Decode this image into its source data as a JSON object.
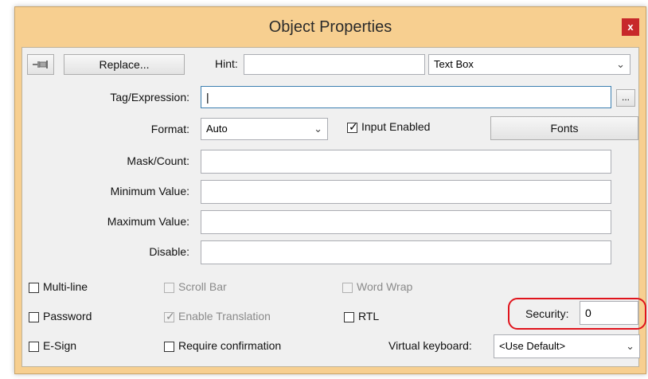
{
  "window": {
    "title": "Object Properties",
    "close_glyph": "x",
    "accent_color": "#f7cf90",
    "close_color": "#c7282a"
  },
  "toolbar": {
    "pin_icon": "pushpin-icon",
    "replace_label": "Replace...",
    "hint_label": "Hint:",
    "hint_value": "",
    "type_selected": "Text Box"
  },
  "fields": {
    "tag_label": "Tag/Expression:",
    "tag_value": "|",
    "browse_label": "...",
    "format_label": "Format:",
    "format_selected": "Auto",
    "input_enabled_label": "Input Enabled",
    "input_enabled_checked": true,
    "fonts_label": "Fonts",
    "mask_label": "Mask/Count:",
    "mask_value": "",
    "min_label": "Minimum Value:",
    "min_value": "",
    "max_label": "Maximum Value:",
    "max_value": "",
    "disable_label": "Disable:",
    "disable_value": ""
  },
  "options": {
    "multiline_label": "Multi-line",
    "multiline_checked": false,
    "scrollbar_label": "Scroll Bar",
    "scrollbar_checked": false,
    "wordwrap_label": "Word Wrap",
    "wordwrap_checked": false,
    "password_label": "Password",
    "password_checked": false,
    "translation_label": "Enable Translation",
    "translation_checked": true,
    "rtl_label": "RTL",
    "rtl_checked": false,
    "esign_label": "E-Sign",
    "esign_checked": false,
    "confirm_label": "Require confirmation",
    "confirm_checked": false,
    "security_label": "Security:",
    "security_value": "0",
    "vkeyboard_label": "Virtual keyboard:",
    "vkeyboard_selected": "<Use Default>",
    "highlight_color": "#e0141c"
  }
}
